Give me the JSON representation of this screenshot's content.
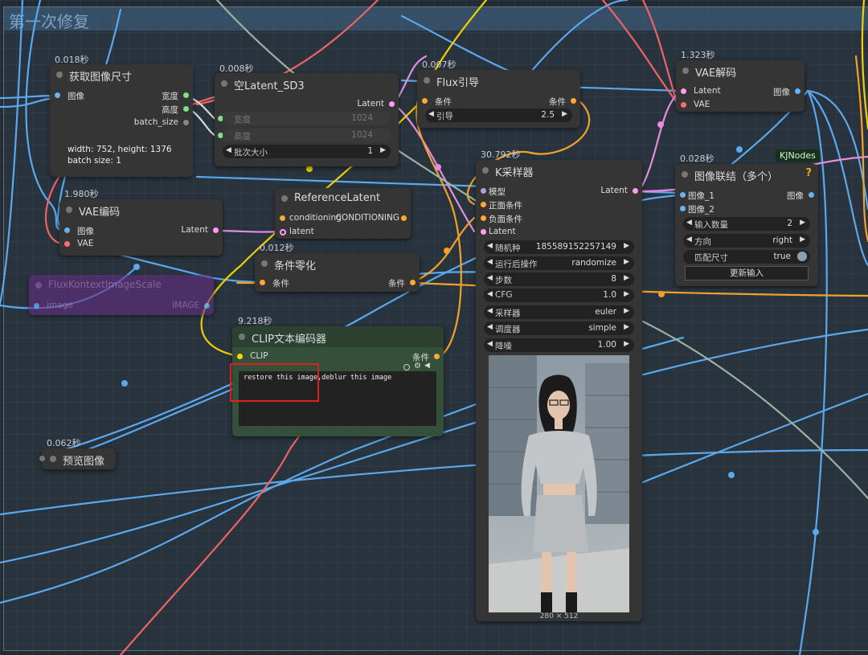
{
  "group": {
    "title": "第一次修复"
  },
  "nodes": {
    "get_size": {
      "timing": "0.018秒",
      "title": "获取图像尺寸",
      "input_image": "图像",
      "out_width": "宽度",
      "out_height": "高度",
      "out_batch": "batch_size",
      "info_line1": "width: 752, height: 1376",
      "info_line2": "batch size: 1"
    },
    "empty_latent": {
      "timing": "0.008秒",
      "title": "空Latent_SD3",
      "out_latent": "Latent",
      "width_label": "宽度",
      "width_value": "1024",
      "height_label": "高度",
      "height_value": "1024",
      "batch_label": "批次大小",
      "batch_value": "1"
    },
    "flux_guidance": {
      "timing": "0.007秒",
      "title": "Flux引导",
      "in_cond": "条件",
      "out_cond": "条件",
      "guidance_label": "引导",
      "guidance_value": "2.5"
    },
    "vae_decode": {
      "timing": "1.323秒",
      "title": "VAE解码",
      "in_latent": "Latent",
      "in_vae": "VAE",
      "out_image": "图像"
    },
    "vae_encode": {
      "timing": "1.980秒",
      "title": "VAE编码",
      "in_image": "图像",
      "in_vae": "VAE",
      "out_latent": "Latent"
    },
    "reference_latent": {
      "title": "ReferenceLatent",
      "in_conditioning": "conditioning",
      "out_conditioning": "CONDITIONING",
      "in_latent": "latent"
    },
    "cond_zero": {
      "timing": "0.012秒",
      "title": "条件零化",
      "in_cond": "条件",
      "out_cond": "条件"
    },
    "flux_scale": {
      "title": "FluxKontextImageScale",
      "in_image": "image",
      "out_image": "IMAGE"
    },
    "clip_encode": {
      "timing": "9.218秒",
      "title": "CLIP文本编码器",
      "in_clip": "CLIP",
      "out_cond": "条件",
      "prompt": "restore this image,deblur this image"
    },
    "preview": {
      "timing": "0.062秒",
      "title": "预览图像"
    },
    "ksampler": {
      "timing": "30.792秒",
      "title": "K采样器",
      "in_model": "模型",
      "in_pos": "正面条件",
      "in_neg": "负面条件",
      "in_latent": "Latent",
      "out_latent": "Latent",
      "widgets": [
        {
          "label": "随机种",
          "value": "185589152257149"
        },
        {
          "label": "运行后操作",
          "value": "randomize"
        },
        {
          "label": "步数",
          "value": "8"
        },
        {
          "label": "CFG",
          "value": "1.0"
        },
        {
          "label": "采样器",
          "value": "euler"
        },
        {
          "label": "调度器",
          "value": "simple"
        },
        {
          "label": "降噪",
          "value": "1.00"
        }
      ],
      "preview_size": "280 × 512"
    },
    "image_concat": {
      "timing": "0.028秒",
      "title": "图像联结（多个）",
      "badge": "KJNodes",
      "help": "?",
      "in_image1": "图像_1",
      "in_image2": "图像_2",
      "out_image": "图像",
      "count_label": "输入数量",
      "count_value": "2",
      "direction_label": "方向",
      "direction_value": "right",
      "match_label": "匹配尺寸",
      "match_value": "true",
      "update_button": "更新输入"
    }
  },
  "colors": {
    "latent": "#ff9cf9",
    "image": "#64b5f6",
    "vae": "#ff6e6e",
    "conditioning": "#ffa931",
    "clip": "#ffd500",
    "model": "#b39ddb",
    "int": "#7ee08a",
    "clip_node_bg": "#2f4a2f",
    "flux_scale_bg": "#5a2c6e"
  }
}
